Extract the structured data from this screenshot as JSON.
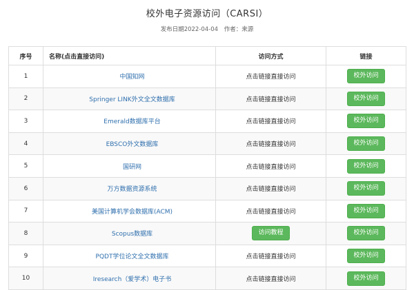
{
  "header": {
    "title": "校外电子资源访问（CARSI）",
    "publish_date": "发布日期2022-04-04",
    "author": "作者：来源"
  },
  "table": {
    "columns": [
      "序号",
      "名称(点击直接访问)",
      "访问方式",
      "链接"
    ],
    "rows": [
      {
        "index": "1",
        "name": "中国知网",
        "method": "点击链接直接访问",
        "method_is_button": false,
        "link": "校外访问"
      },
      {
        "index": "2",
        "name": "Springer LINK外文全文数据库",
        "method": "点击链接直接访问",
        "method_is_button": false,
        "link": "校外访问"
      },
      {
        "index": "3",
        "name": "Emerald数据库平台",
        "method": "点击链接直接访问",
        "method_is_button": false,
        "link": "校外访问"
      },
      {
        "index": "4",
        "name": "EBSCO外文数据库",
        "method": "点击链接直接访问",
        "method_is_button": false,
        "link": "校外访问"
      },
      {
        "index": "5",
        "name": "国研网",
        "method": "点击链接直接访问",
        "method_is_button": false,
        "link": "校外访问"
      },
      {
        "index": "6",
        "name": "万方数据资源系统",
        "method": "点击链接直接访问",
        "method_is_button": false,
        "link": "校外访问"
      },
      {
        "index": "7",
        "name": "美国计算机学会数据库(ACM)",
        "method": "点击链接直接访问",
        "method_is_button": false,
        "link": "校外访问"
      },
      {
        "index": "8",
        "name": "Scopus数据库",
        "method": "访问教程",
        "method_is_button": true,
        "link": "校外访问"
      },
      {
        "index": "9",
        "name": "PQDT学位论文全文数据库",
        "method": "点击链接直接访问",
        "method_is_button": false,
        "link": "校外访问"
      },
      {
        "index": "10",
        "name": "Iresearch（爱学术）电子书",
        "method": "点击链接直接访问",
        "method_is_button": false,
        "link": "校外访问"
      }
    ]
  },
  "colors": {
    "button_green": "#5cb85c",
    "link_blue": "#2f6fad"
  }
}
